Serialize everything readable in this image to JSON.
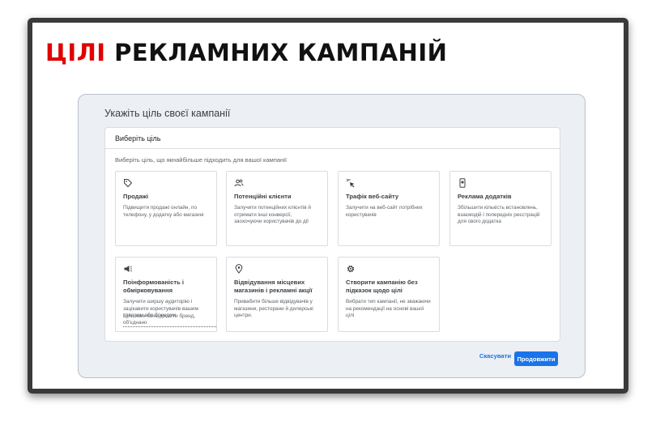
{
  "slide": {
    "title_accent": "ЦІЛІ",
    "title_rest": " РЕКЛАМНИХ КАМПАНІЙ",
    "accent_color": "#e00000"
  },
  "dialog": {
    "heading": "Укажіть ціль своєї кампанії",
    "card_header": "Виберіть ціль",
    "hint": "Виберіть ціль, що якнайбільше підходить для вашої кампанії",
    "options": [
      {
        "icon": "tag-icon",
        "title": "Продажі",
        "description": "Підвищити продажі онлайн, по телефону, у додатку або магазині"
      },
      {
        "icon": "people-icon",
        "title": "Потенційні клієнти",
        "description": "Залучити потенційних клієнтів й отримати інші конверсії, заохочуючи користувачів до дії"
      },
      {
        "icon": "cursor-click-icon",
        "title": "Трафік веб-сайту",
        "description": "Залучити на веб-сайт потрібних користувачів"
      },
      {
        "icon": "mobile-phone-icon",
        "title": "Реклама додатків",
        "description": "Збільшити кількість встановлень, взаємодій і попередніх реєстрацій для свого додатка"
      },
      {
        "icon": "megaphone-icon",
        "title": "Поінформованість і обмірковування",
        "description": "Залучити ширшу аудиторію і зацікавити користувачів вашим товаром або брендом",
        "link": "Цілі, яких хоче досягти бренд, об'єднано"
      },
      {
        "icon": "location-pin-icon",
        "title": "Відвідування місцевих магазинів і рекламні акції",
        "description": "Привабити більше відвідувачів у магазини, ресторани й дилерські центри."
      },
      {
        "icon": "gear-icon",
        "title": "Створити кампанію без підказок щодо цілі",
        "description": "Вибрати тип кампанії, не зважаючи на рекомендації на основі вашої цілі"
      }
    ],
    "cancel_label": "Скасувати",
    "continue_label": "Продовжити",
    "primary_color": "#1a73e8"
  }
}
